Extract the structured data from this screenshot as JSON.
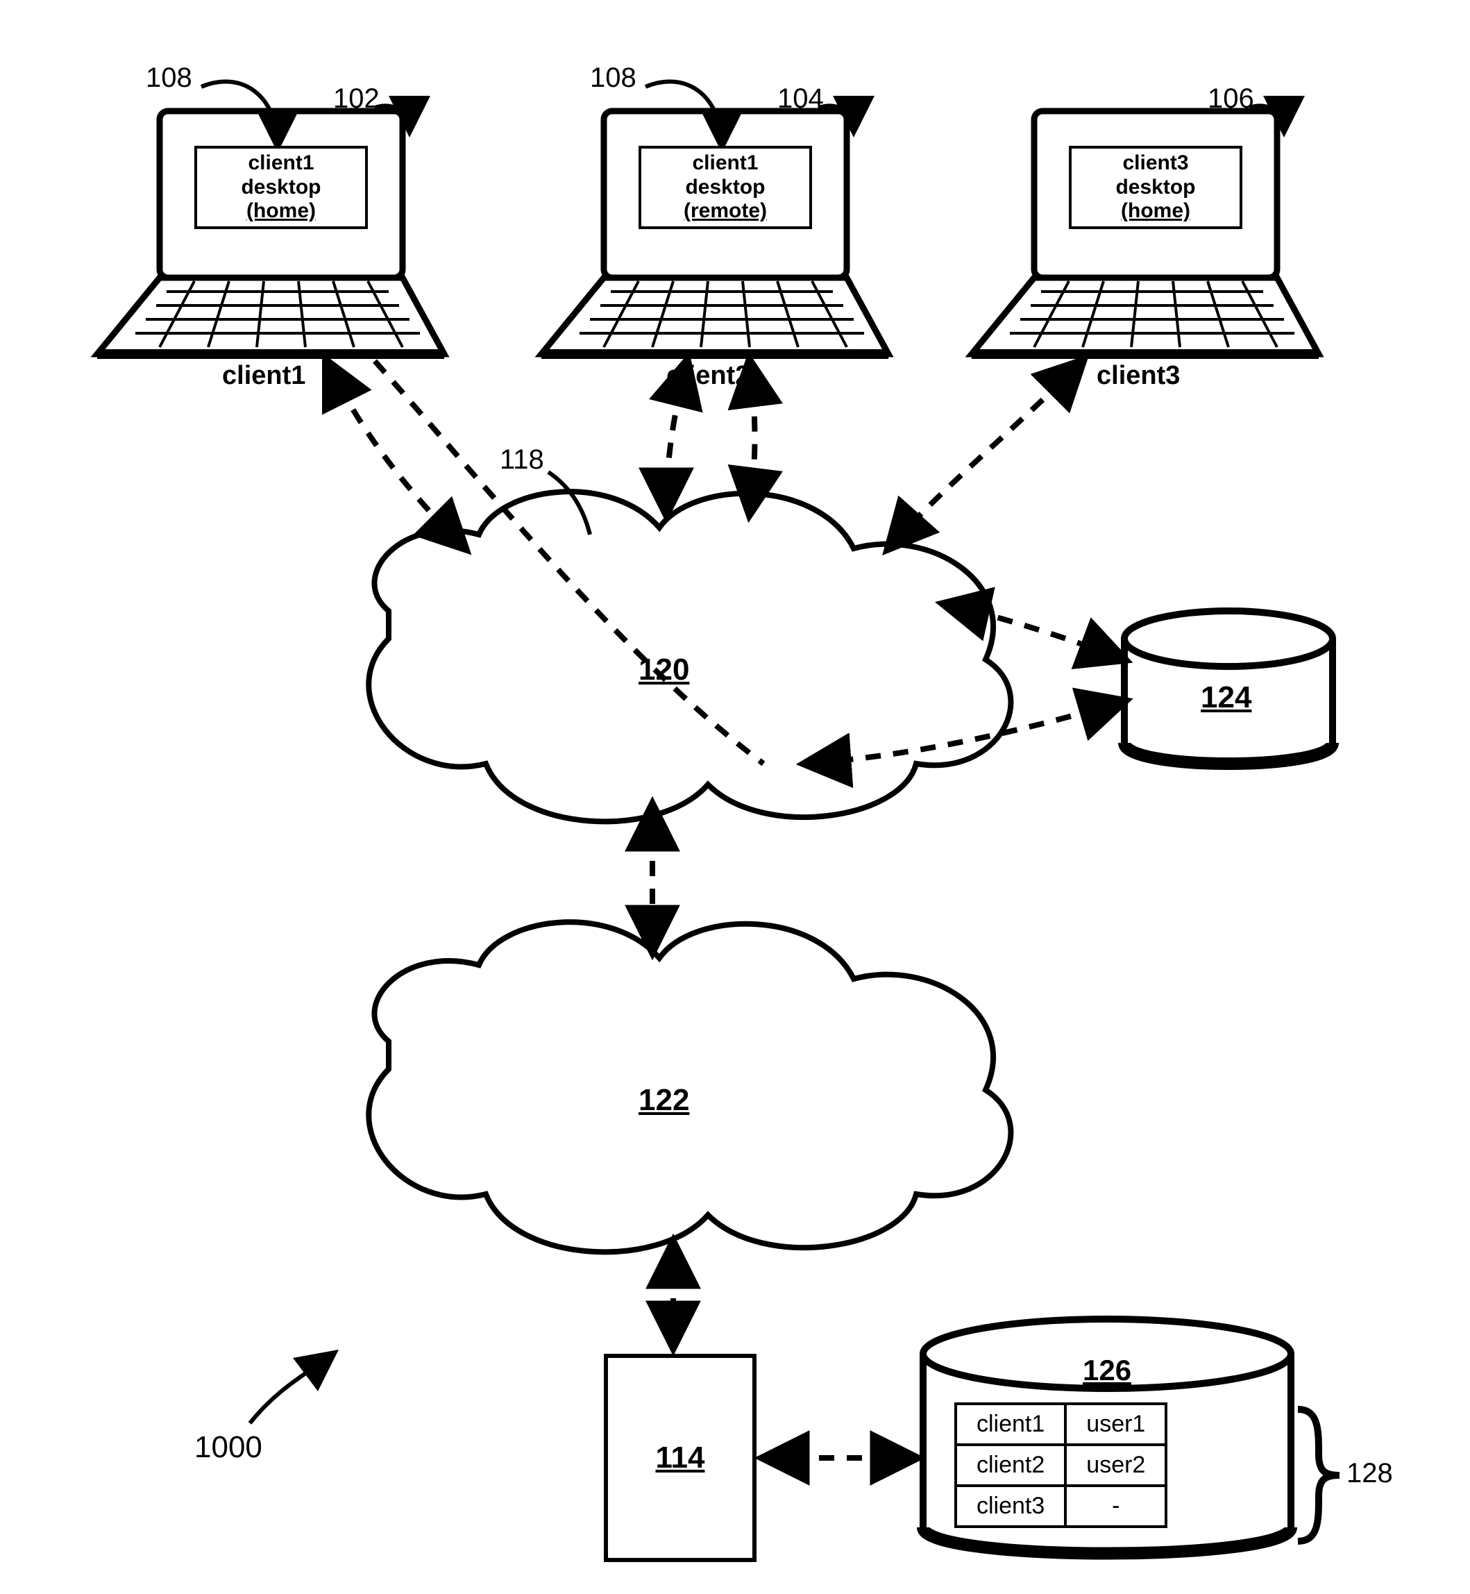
{
  "refs": {
    "r108a": "108",
    "r102": "102",
    "r108b": "108",
    "r104": "104",
    "r106": "106",
    "r118": "118",
    "r120": "120",
    "r124": "124",
    "r122": "122",
    "r114": "114",
    "r126": "126",
    "r128": "128",
    "r1000": "1000"
  },
  "laptops": {
    "c1": {
      "name": "client1",
      "screen_l1": "client1",
      "screen_l2": "desktop",
      "screen_l3": "(home)"
    },
    "c2": {
      "name": "client2",
      "screen_l1": "client1",
      "screen_l2": "desktop",
      "screen_l3": "(remote)"
    },
    "c3": {
      "name": "client3",
      "screen_l1": "client3",
      "screen_l2": "desktop",
      "screen_l3": "(home)"
    }
  },
  "table": {
    "r1c1": "client1",
    "r1c2": "user1",
    "r2c1": "client2",
    "r2c2": "user2",
    "r3c1": "client3",
    "r3c2": "-"
  }
}
